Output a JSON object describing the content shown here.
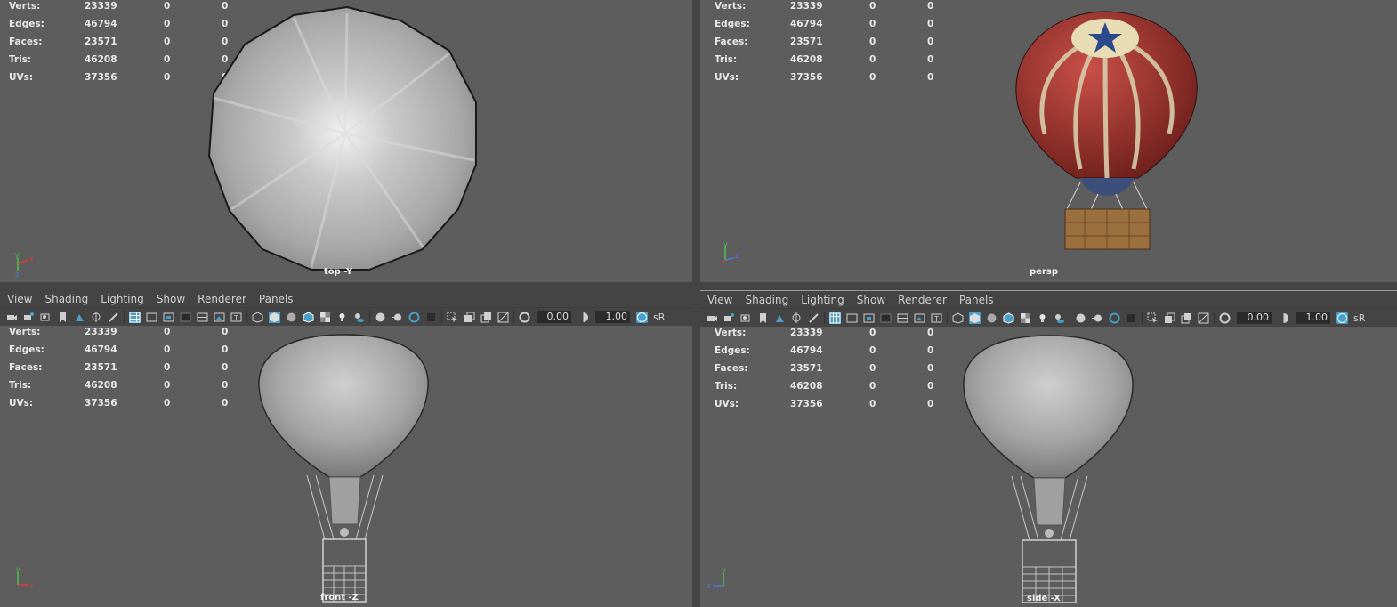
{
  "stats_labels": [
    "Verts:",
    "Edges:",
    "Faces:",
    "Tris:",
    "UVs:"
  ],
  "stats_values": [
    [
      "23339",
      "0",
      "0"
    ],
    [
      "46794",
      "0",
      "0"
    ],
    [
      "23571",
      "0",
      "0"
    ],
    [
      "46208",
      "0",
      "0"
    ],
    [
      "37356",
      "0",
      "0"
    ]
  ],
  "menu": {
    "view": "View",
    "shading": "Shading",
    "lighting": "Lighting",
    "show": "Show",
    "renderer": "Renderer",
    "panels": "Panels"
  },
  "toolbar": {
    "exposure": "0.00",
    "gamma": "1.00",
    "color_space": "sR"
  },
  "cameras": {
    "top": "top -Y",
    "persp": "persp",
    "front": "front -Z",
    "side": "side -X"
  },
  "axes": {
    "y": "y",
    "x": "x",
    "z": "z"
  },
  "colors": {
    "viewport_bg": "#5d5d5d",
    "panel_bar": "#444444",
    "active_icon": "#4a9fc9",
    "axis_x": "#e03c3c",
    "axis_y": "#4cc24c",
    "axis_z": "#4c7fe0"
  }
}
